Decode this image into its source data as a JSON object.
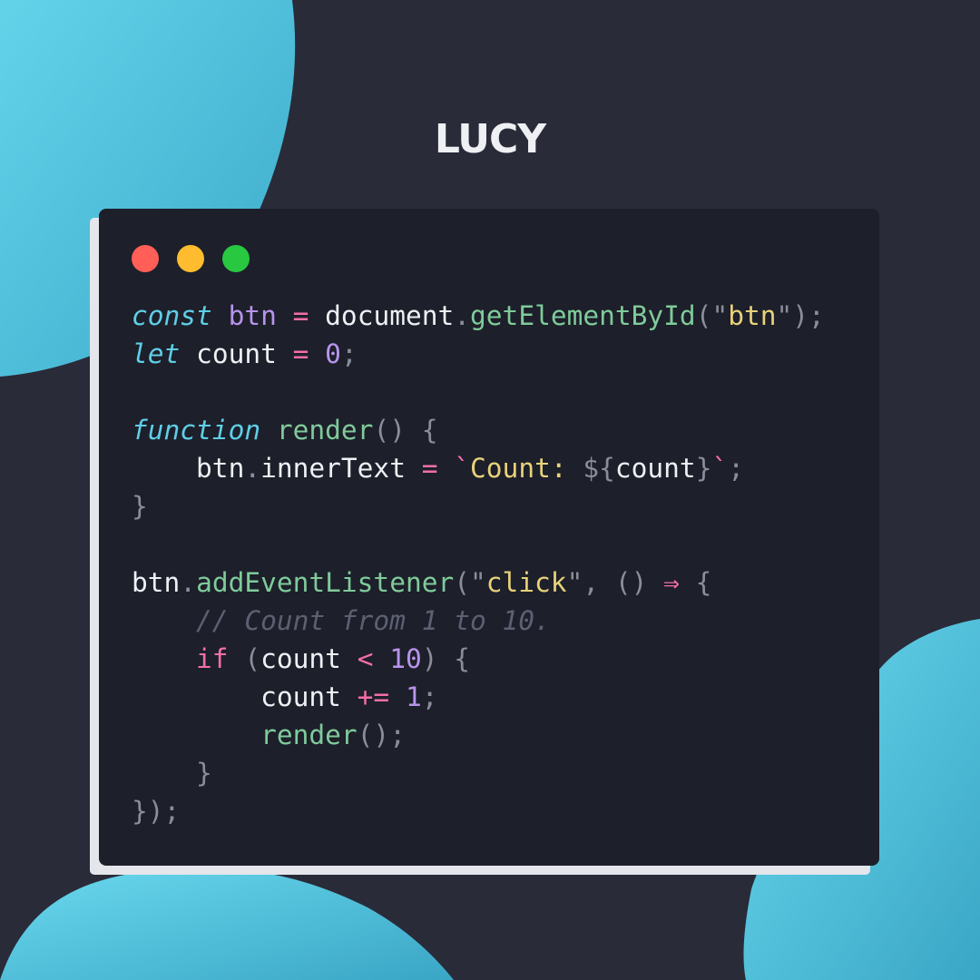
{
  "brand": {
    "title": "LUCY"
  },
  "window": {
    "controls": [
      "close",
      "minimize",
      "maximize"
    ]
  },
  "colors": {
    "background": "#292b38",
    "card": "#1d1f2a",
    "blob": "#5ecfe6",
    "keyword": "#5ecfe6",
    "variable": "#b894ec",
    "operator": "#f46fa6",
    "function": "#7fcb9a",
    "string": "#e8d27a",
    "comment": "#5d6072"
  },
  "code": {
    "l1": {
      "kw": "const",
      "name": "btn",
      "op": "=",
      "obj": "document",
      "dot": ".",
      "fn": "getElementById",
      "open": "(\"",
      "str": "btn",
      "close": "\");"
    },
    "l2": {
      "kw": "let",
      "name": "count",
      "op": "=",
      "num": "0",
      "end": ";"
    },
    "l4": {
      "kw": "function",
      "fn": "render",
      "rest": "() {"
    },
    "l5": {
      "obj": "btn",
      "dot": ".",
      "prop": "innerText",
      "op": "=",
      "tick": "`",
      "str": "Count: ",
      "interp_open": "${",
      "var": "count",
      "interp_close": "}",
      "tick2": "`",
      "end": ";"
    },
    "l6": {
      "close": "}"
    },
    "l8": {
      "obj": "btn",
      "dot": ".",
      "fn": "addEventListener",
      "open": "(\"",
      "str": "click",
      "close": "\", () ",
      "arrow": "⇒",
      "brace": " {"
    },
    "l9": {
      "comment": "// Count from 1 to 10."
    },
    "l10": {
      "kw": "if",
      "open": " (",
      "var": "count",
      "op": "<",
      "num": "10",
      "close": ") {"
    },
    "l11": {
      "var": "count",
      "op": "+=",
      "num": "1",
      "end": ";"
    },
    "l12": {
      "fn": "render",
      "end": "();"
    },
    "l13": {
      "close": "}"
    },
    "l14": {
      "close": "});"
    }
  }
}
